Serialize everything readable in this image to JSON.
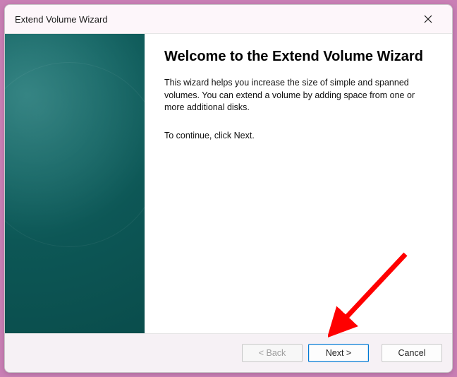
{
  "window": {
    "title": "Extend Volume Wizard"
  },
  "main": {
    "heading": "Welcome to the Extend Volume Wizard",
    "description": "This wizard helps you increase the size of simple and spanned volumes. You can extend a volume  by adding space from one or more additional disks.",
    "continue_hint": "To continue, click Next."
  },
  "footer": {
    "back_label": "< Back",
    "next_label": "Next >",
    "cancel_label": "Cancel"
  }
}
